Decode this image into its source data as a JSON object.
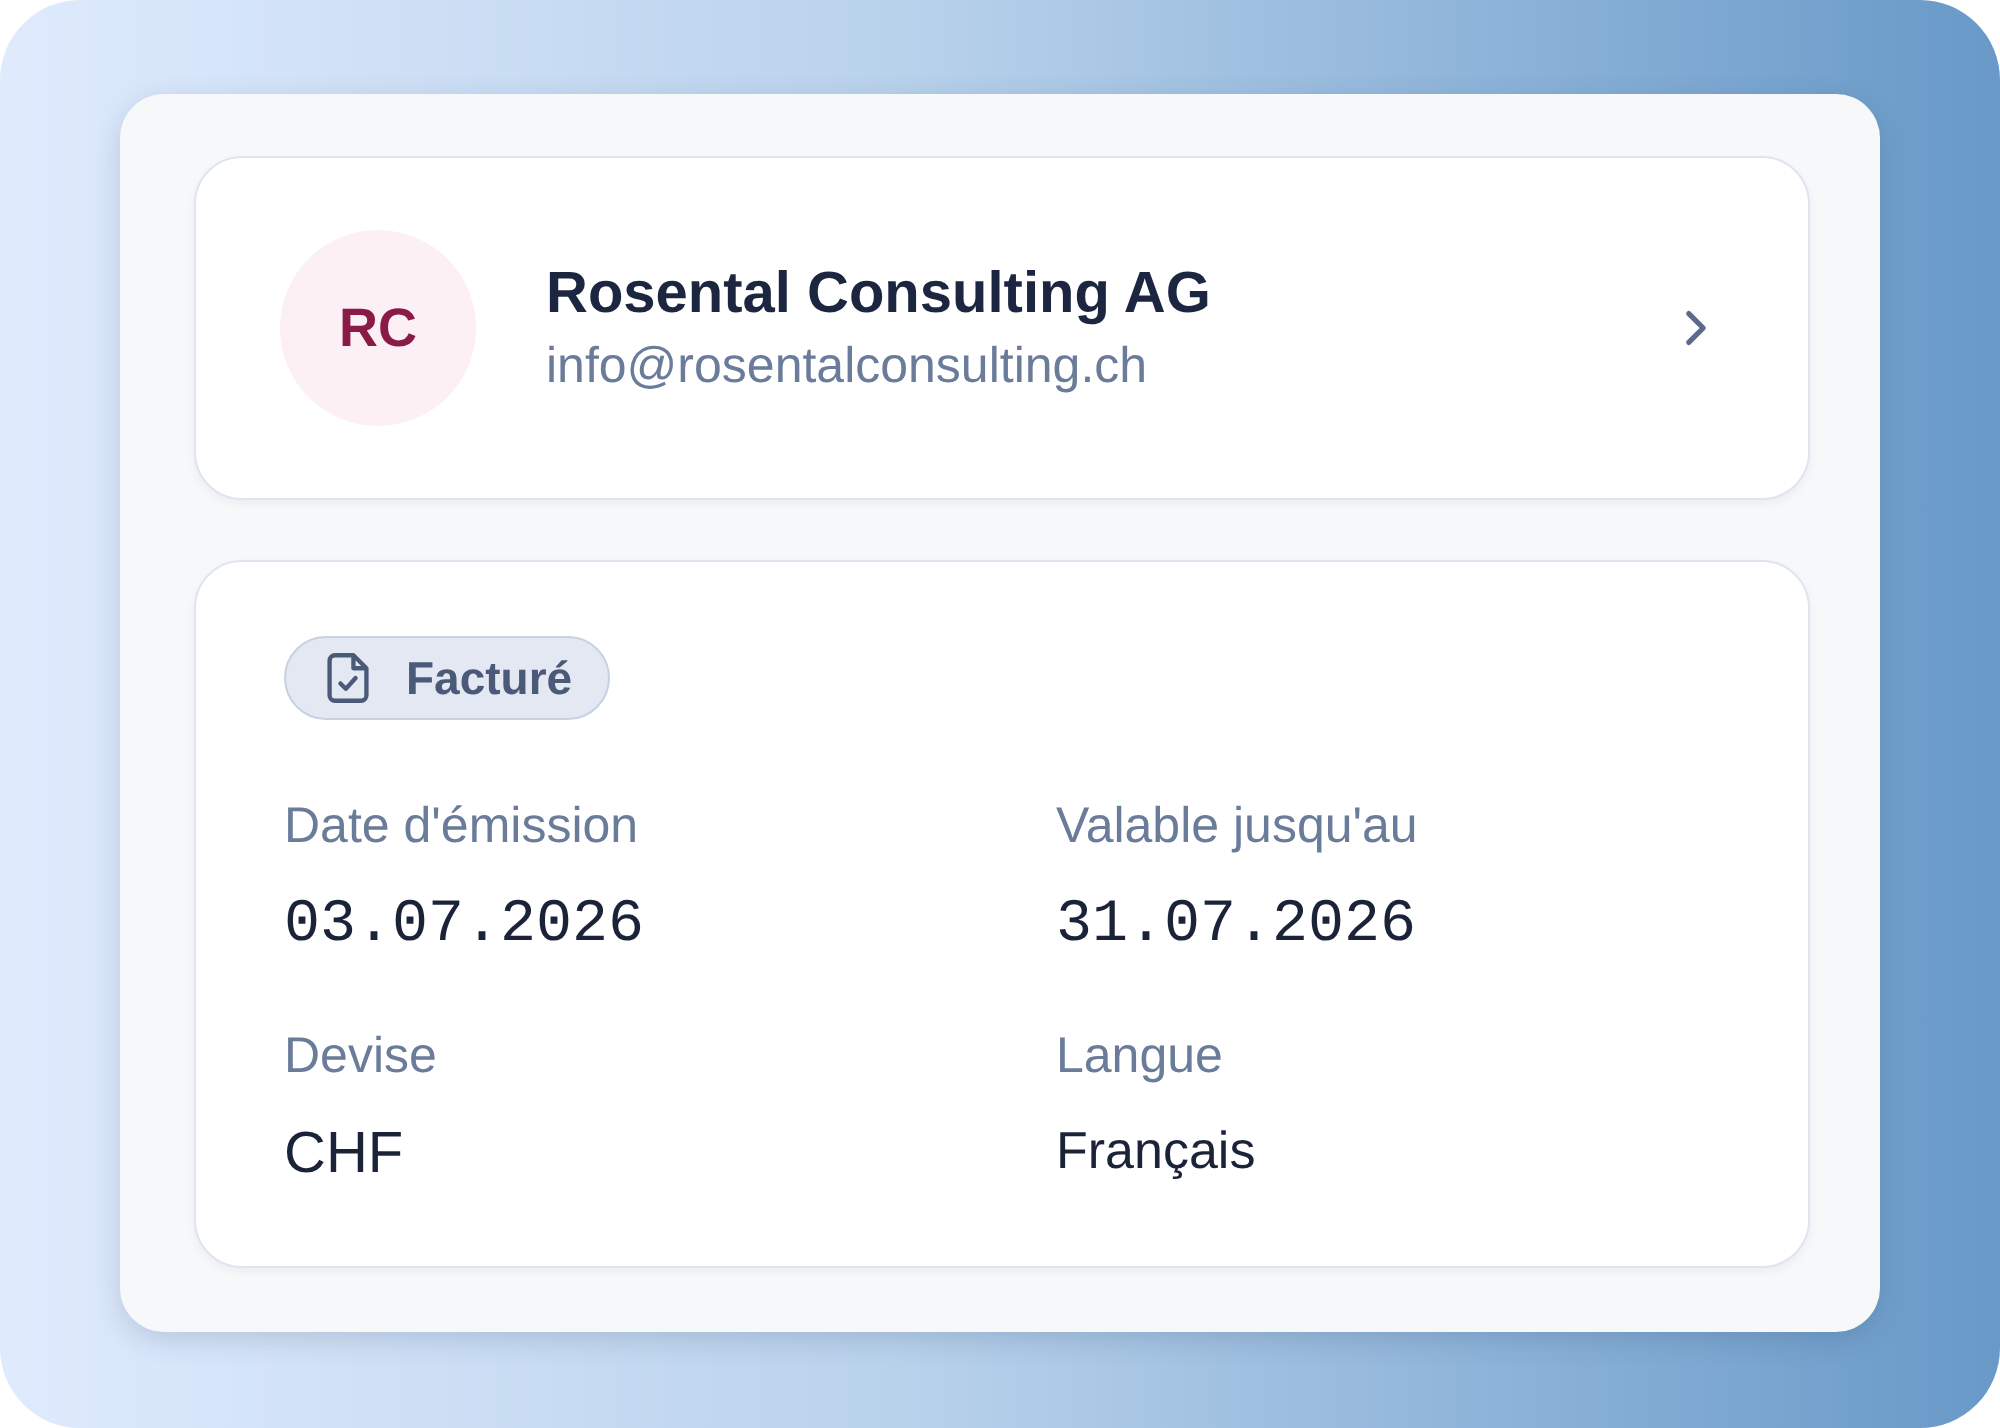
{
  "client": {
    "initials": "RC",
    "name": "Rosental Consulting AG",
    "email": "info@rosentalconsulting.ch"
  },
  "status_badge": {
    "label": "Facturé"
  },
  "fields": [
    {
      "label": "Date d'émission",
      "value": "03.07.2026",
      "kind": "date"
    },
    {
      "label": "Valable jusqu'au",
      "value": "31.07.2026",
      "kind": "date"
    },
    {
      "label": "Devise",
      "value": "CHF",
      "kind": "code"
    },
    {
      "label": "Langue",
      "value": "Français",
      "kind": "text"
    }
  ]
}
